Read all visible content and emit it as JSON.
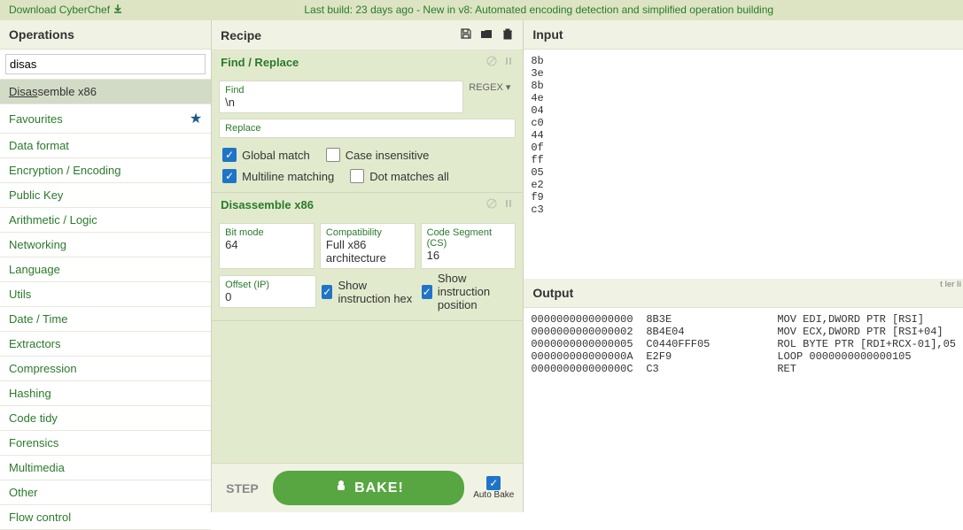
{
  "banner": {
    "download": "Download CyberChef",
    "center1": "Last build: 23 days ago - New in v8: ",
    "center2": "Automated encoding detection",
    "center3": " and ",
    "center4": "simplified operation building"
  },
  "operations": {
    "title": "Operations",
    "search": "disas",
    "result": {
      "match": "Disas",
      "rest": "semble x86"
    },
    "favourites": "Favourites",
    "categories": [
      "Data format",
      "Encryption / Encoding",
      "Public Key",
      "Arithmetic / Logic",
      "Networking",
      "Language",
      "Utils",
      "Date / Time",
      "Extractors",
      "Compression",
      "Hashing",
      "Code tidy",
      "Forensics",
      "Multimedia",
      "Other",
      "Flow control"
    ]
  },
  "recipe": {
    "title": "Recipe",
    "ops": [
      {
        "name": "Find / Replace",
        "find_label": "Find",
        "find_value": "\\n",
        "regex_label": "REGEX ▾",
        "replace_label": "Replace",
        "replace_value": "",
        "checks": [
          {
            "label": "Global match",
            "checked": true
          },
          {
            "label": "Case insensitive",
            "checked": false
          },
          {
            "label": "Multiline matching",
            "checked": true
          },
          {
            "label": "Dot matches all",
            "checked": false
          }
        ]
      },
      {
        "name": "Disassemble x86",
        "fields": [
          {
            "label": "Bit mode",
            "value": "64"
          },
          {
            "label": "Compatibility",
            "value": "Full x86 architecture"
          },
          {
            "label": "Code Segment (CS)",
            "value": "16"
          },
          {
            "label": "Offset (IP)",
            "value": "0"
          }
        ],
        "checks": [
          {
            "label": "Show instruction hex",
            "checked": true
          },
          {
            "label": "Show instruction position",
            "checked": true
          }
        ]
      }
    ],
    "step": "STEP",
    "bake": "BAKE!",
    "auto_bake": "Auto Bake"
  },
  "input": {
    "title": "Input",
    "text": "8b\n3e\n8b\n4e\n04\nc0\n44\n0f\nff\n05\ne2\nf9\nc3"
  },
  "output": {
    "title": "Output",
    "stats": "t\nler\nli",
    "lines": [
      {
        "a": "0000000000000000",
        "b": "8B3E",
        "c": "MOV EDI,DWORD PTR [RSI]"
      },
      {
        "a": "0000000000000002",
        "b": "8B4E04",
        "c": "MOV ECX,DWORD PTR [RSI+04]"
      },
      {
        "a": "0000000000000005",
        "b": "C0440FFF05",
        "c": "ROL BYTE PTR [RDI+RCX-01],05"
      },
      {
        "a": "000000000000000A",
        "b": "E2F9",
        "c": "LOOP 0000000000000105"
      },
      {
        "a": "000000000000000C",
        "b": "C3",
        "c": "RET"
      }
    ]
  }
}
